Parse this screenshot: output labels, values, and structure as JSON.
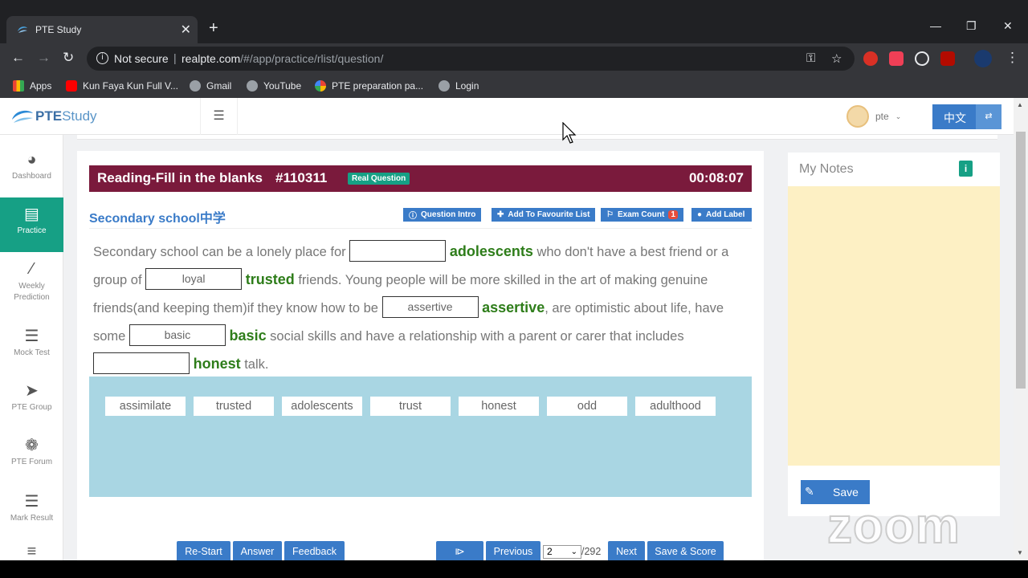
{
  "browser": {
    "tab_title": "PTE Study",
    "not_secure": "Not secure",
    "url_host": "realpte.com",
    "url_path": "/#/app/practice/rlist/question/",
    "bookmarks": [
      {
        "label": "Apps",
        "color": "#ea4335"
      },
      {
        "label": "Kun Faya Kun Full V...",
        "color": "#ff0000"
      },
      {
        "label": "Gmail",
        "color": "#9aa0a6"
      },
      {
        "label": "YouTube",
        "color": "#9aa0a6"
      },
      {
        "label": "PTE preparation pa...",
        "color": "#4285f4"
      },
      {
        "label": "Login",
        "color": "#9aa0a6"
      }
    ]
  },
  "app": {
    "logo_bold": "PTE",
    "logo_light": "Study",
    "user_name": "pte",
    "lang_label": "中文",
    "sidebar": [
      {
        "label": "Dashboard",
        "icon": "dashboard-icon"
      },
      {
        "label": "Practice",
        "icon": "document-icon"
      },
      {
        "label": "Weekly Prediction",
        "icon": "magic-wand-icon"
      },
      {
        "label": "Mock Test",
        "icon": "server-icon"
      },
      {
        "label": "PTE Group",
        "icon": "paper-plane-icon"
      },
      {
        "label": "PTE Forum",
        "icon": "wechat-icon"
      },
      {
        "label": "Mark Result",
        "icon": "server-icon"
      }
    ]
  },
  "question": {
    "type": "Reading-Fill in the blanks",
    "number": "#110311",
    "badge": "Real Question",
    "timer": "00:08:07",
    "title": "Secondary school中学",
    "actions": {
      "intro": "Question Intro",
      "favourite": "Add To Favourite List",
      "exam_count": "Exam Count",
      "exam_count_value": "1",
      "label": "Add Label"
    },
    "passage": {
      "p1": "Secondary school can be a lonely place for",
      "b1": "",
      "a1": "adolescents",
      "p2": "who don't have a best friend or a group of",
      "b2": "loyal",
      "a2": "trusted",
      "p3": "friends. Young people will be more skilled in the art of making genuine friends(and keeping them)if they know how to be",
      "b3": "assertive",
      "a3": "assertive",
      "p4": ", are optimistic about life, have some",
      "b4": "basic",
      "a4": "basic",
      "p5": "social skills and have a relationship with a parent or carer that includes",
      "b5": "",
      "a5": "honest",
      "p6": "talk."
    },
    "word_bank": [
      "assimilate",
      "trusted",
      "adolescents",
      "trust",
      "honest",
      "odd",
      "adulthood"
    ]
  },
  "footer": {
    "restart": "Re-Start",
    "answer": "Answer",
    "feedback": "Feedback",
    "play": "⧐",
    "previous": "Previous",
    "page_current": "2",
    "page_total": "/292",
    "next": "Next",
    "save_score": "Save & Score"
  },
  "notes": {
    "title": "My Notes",
    "info": "i",
    "save": "Save"
  },
  "watermark": "zoom"
}
